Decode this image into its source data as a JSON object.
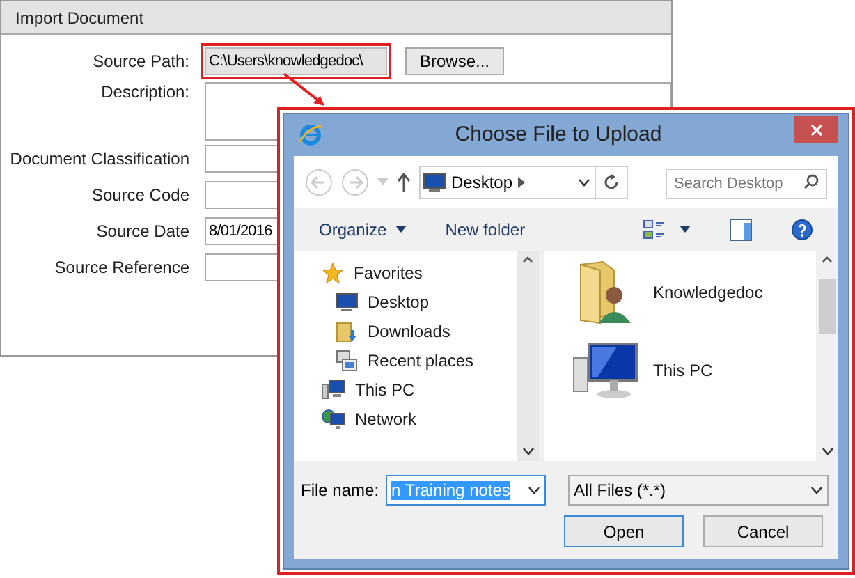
{
  "form": {
    "title": "Import Document",
    "fields": [
      {
        "kind": "path",
        "label": "Source Path:",
        "value": "C:\\Users\\knowledgedoc\\",
        "button": "Browse...",
        "highlighted": true
      },
      {
        "kind": "textarea",
        "label": "Description:"
      },
      {
        "kind": "text",
        "label": "Document Classification"
      },
      {
        "kind": "text",
        "label": "Source Code"
      },
      {
        "kind": "text",
        "label": "Source Date",
        "value": "8/01/2016"
      },
      {
        "kind": "text",
        "label": "Source Reference"
      }
    ]
  },
  "dialog": {
    "title": "Choose File to Upload",
    "address": "Desktop",
    "search": {
      "placeholder": "Search Desktop"
    },
    "toolbar": [
      "Organize",
      "New folder"
    ],
    "nav": [
      {
        "label": "Favorites",
        "children": [
          {
            "label": "Desktop"
          },
          {
            "label": "Downloads"
          },
          {
            "label": "Recent places"
          }
        ]
      },
      {
        "label": "This PC"
      },
      {
        "label": "Network"
      }
    ],
    "items": [
      {
        "label": "Knowledgedoc"
      },
      {
        "label": "This PC"
      }
    ],
    "file_name": {
      "label": "File name:",
      "value": "n Training notes"
    },
    "filter": "All Files (*.*)",
    "buttons": [
      {
        "label": "Open",
        "default": true
      },
      {
        "label": "Cancel",
        "default": false
      }
    ]
  }
}
